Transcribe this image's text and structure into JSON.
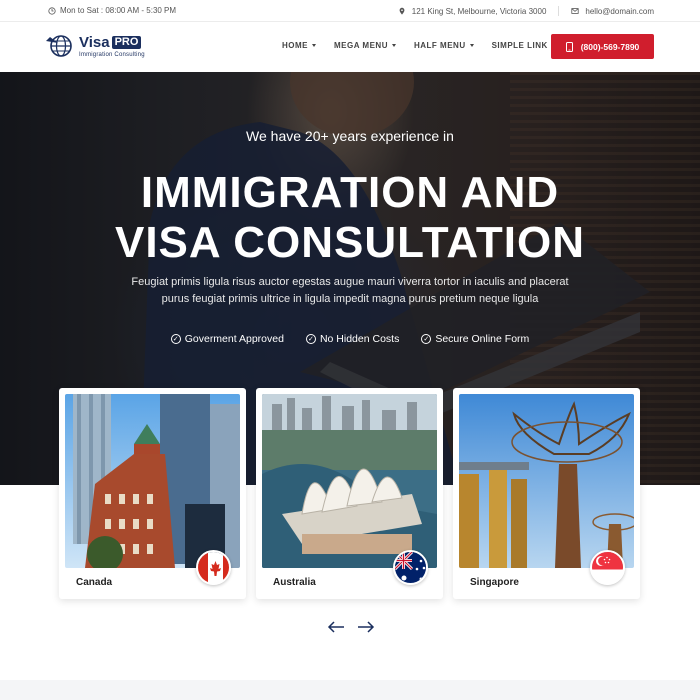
{
  "topbar": {
    "hours": "Mon to Sat : 08:00 AM - 5:30 PM",
    "address": "121 King St, Melbourne, Victoria 3000",
    "email": "hello@domain.com"
  },
  "logo": {
    "brand": "Visa",
    "badge": "PRO",
    "tagline": "Immigration Consulting",
    "icon": "globe-plane-icon"
  },
  "nav": {
    "items": [
      {
        "label": "HOME",
        "dropdown": true
      },
      {
        "label": "MEGA MENU",
        "dropdown": true
      },
      {
        "label": "HALF MENU",
        "dropdown": true
      },
      {
        "label": "SIMPLE LINK",
        "dropdown": false
      }
    ],
    "phone": "(800)-569-7890"
  },
  "hero": {
    "kicker": "We have 20+ years experience in",
    "title_line1": "IMMIGRATION AND",
    "title_line2": "VISA CONSULTATION",
    "description": "Feugiat primis ligula risus auctor egestas augue mauri viverra tortor in iaculis and placerat purus feugiat primis ultrice in ligula impedit magna purus pretium neque ligula",
    "features": [
      "Goverment Approved",
      "No Hidden Costs",
      "Secure Online Form"
    ]
  },
  "destinations": [
    {
      "name": "Canada",
      "flag": "canada-flag-icon"
    },
    {
      "name": "Australia",
      "flag": "australia-flag-icon"
    },
    {
      "name": "Singapore",
      "flag": "singapore-flag-icon"
    }
  ],
  "colors": {
    "accent": "#d01e2d",
    "brand_navy": "#1b2f5e",
    "arrow": "#1b2f5e"
  }
}
